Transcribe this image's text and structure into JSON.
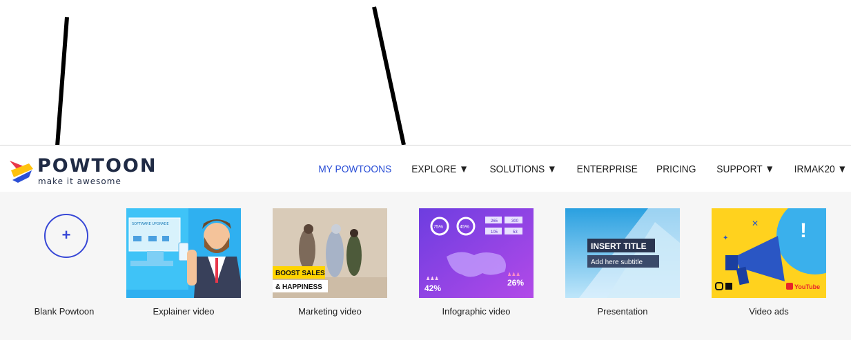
{
  "brand": {
    "name": "POWTOON",
    "tagline": "make it awesome",
    "colors": {
      "navy": "#1f2a44",
      "red": "#e8374a",
      "yellow": "#ffc20e",
      "blue": "#2b4fd6"
    }
  },
  "nav": {
    "items": [
      {
        "label": "MY POWTOONS",
        "active": true
      },
      {
        "label": "EXPLORE ▼",
        "active": false
      },
      {
        "label": "SOLUTIONS ▼",
        "active": false
      },
      {
        "label": "ENTERPRISE",
        "active": false
      },
      {
        "label": "PRICING",
        "active": false
      },
      {
        "label": "SUPPORT ▼",
        "active": false
      },
      {
        "label": "IRMAK20 ▼",
        "active": false
      }
    ]
  },
  "templates": [
    {
      "label": "Blank Powtoon",
      "icon": "plus-icon"
    },
    {
      "label": "Explainer video",
      "thumb_text": "SOFTWARE UPGRADE"
    },
    {
      "label": "Marketing video",
      "thumb_text_1": "BOOST SALES",
      "thumb_text_2": "& HAPPINESS"
    },
    {
      "label": "Infographic video",
      "stats": [
        "75%",
        "45%",
        "265",
        "300",
        "105",
        "53",
        "42%",
        "26%"
      ]
    },
    {
      "label": "Presentation",
      "thumb_title": "INSERT TITLE",
      "thumb_subtitle": "Add here subtitle"
    },
    {
      "label": "Video ads",
      "thumb_badge": "YouTube"
    }
  ]
}
